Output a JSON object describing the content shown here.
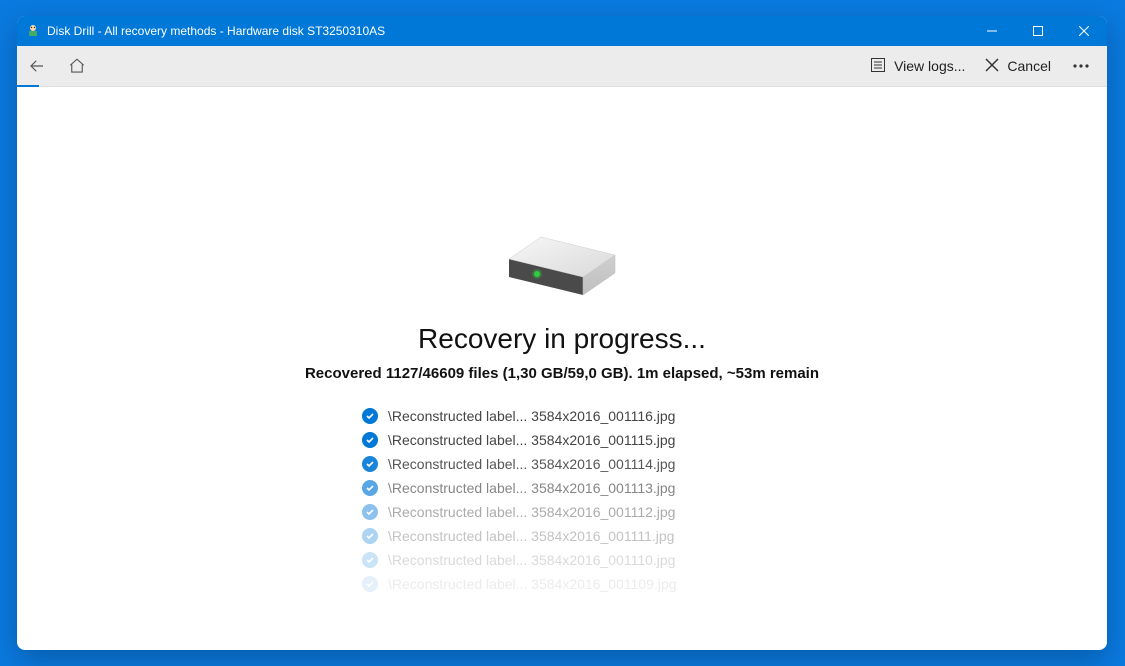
{
  "window": {
    "title": "Disk Drill - All recovery methods - Hardware disk ST3250310AS"
  },
  "toolbar": {
    "view_logs_label": "View logs...",
    "cancel_label": "Cancel"
  },
  "main": {
    "headline": "Recovery in progress...",
    "status_line": "Recovered 1127/46609 files (1,30 GB/59,0 GB). 1m elapsed, ~53m remain",
    "recovery_stats": {
      "recovered_files": 1127,
      "total_files": 46609,
      "recovered_size": "1,30 GB",
      "total_size": "59,0 GB",
      "elapsed": "1m",
      "remaining": "~53m"
    },
    "files": [
      {
        "text": "\\Reconstructed label... 3584x2016_001116.jpg"
      },
      {
        "text": "\\Reconstructed label... 3584x2016_001115.jpg"
      },
      {
        "text": "\\Reconstructed label... 3584x2016_001114.jpg"
      },
      {
        "text": "\\Reconstructed label... 3584x2016_001113.jpg"
      },
      {
        "text": "\\Reconstructed label... 3584x2016_001112.jpg"
      },
      {
        "text": "\\Reconstructed label... 3584x2016_001111.jpg"
      },
      {
        "text": "\\Reconstructed label... 3584x2016_001110.jpg"
      },
      {
        "text": "\\Reconstructed label... 3584x2016_001109.jpg"
      }
    ]
  },
  "colors": {
    "accent": "#0078d7"
  }
}
